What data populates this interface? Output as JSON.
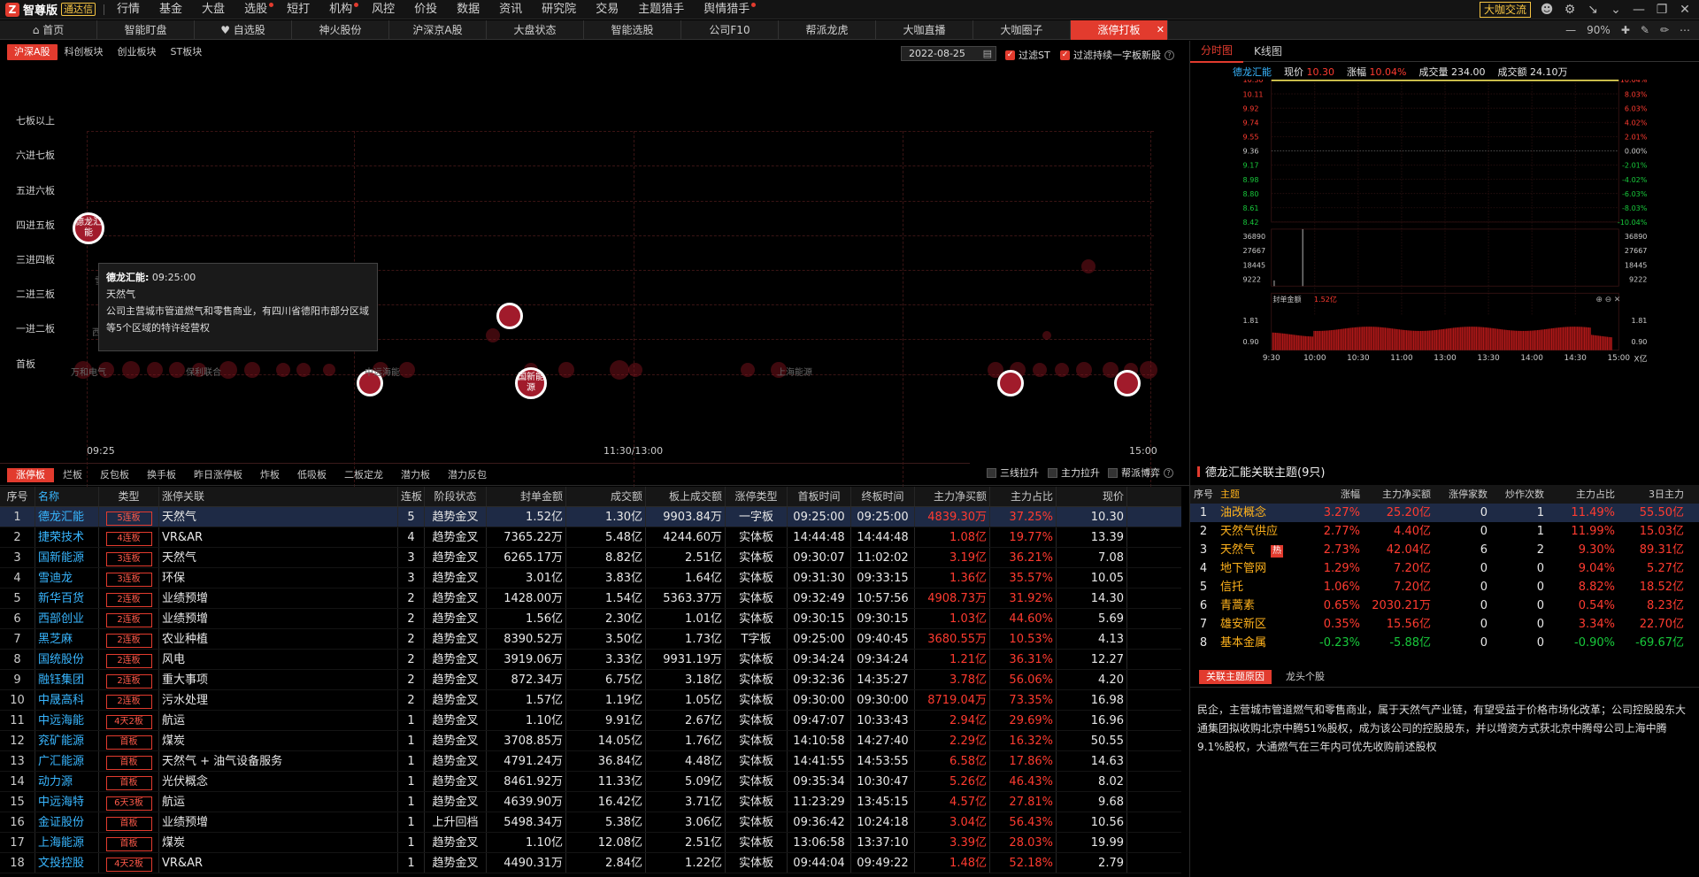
{
  "app": {
    "logo": "智尊版",
    "badge": "通达信",
    "talk_label": "大咖交流",
    "zoom": "90%"
  },
  "menu": [
    "行情",
    "基金",
    "大盘",
    "选股",
    "短打",
    "机构",
    "风控",
    "价投",
    "数据",
    "资讯",
    "研究院",
    "交易",
    "主题猎手",
    "舆情猎手"
  ],
  "menu_dots": [
    false,
    false,
    false,
    true,
    false,
    true,
    false,
    false,
    false,
    false,
    false,
    false,
    false,
    true
  ],
  "tabs": [
    "首页",
    "智能盯盘",
    "自选股",
    "神火股份",
    "沪深京A股",
    "大盘状态",
    "智能选股",
    "公司F10",
    "帮派龙虎",
    "大咖直播",
    "大咖圈子",
    "涨停打板"
  ],
  "filter": {
    "segments": [
      "沪深A股",
      "科创板块",
      "创业板块",
      "ST板块"
    ],
    "date": "2022-08-25",
    "chk_st": "过滤ST",
    "chk_new": "过滤持续一字板新股"
  },
  "levels": [
    "七板以上",
    "六进七板",
    "五进六板",
    "四进五板",
    "三进四板",
    "二进三板",
    "一进二板",
    "首板"
  ],
  "time_axis": {
    "start": "09:25",
    "mid": "11:30/13:00",
    "end": "15:00"
  },
  "bubble_labels": {
    "b1": "德龙汇能",
    "b2": "中远海能",
    "b3": "国新能源",
    "l1": "雪迪龙",
    "l2": "西部创业",
    "l3": "万和电气",
    "l4": "保利联合",
    "l5": "上海能源"
  },
  "tooltip": {
    "name": "德龙汇能:",
    "time": "09:25:00",
    "concept": "天然气",
    "desc": "公司主营城市管道燃气和零售商业，有四川省德阳市部分区域等5个区域的特许经营权"
  },
  "table_tabs": [
    "涨停板",
    "烂板",
    "反包板",
    "换手板",
    "昨日涨停板",
    "炸板",
    "低吸板",
    "二板定龙",
    "潜力板",
    "潜力反包"
  ],
  "options": [
    "三线拉升",
    "主力拉升",
    "帮派博弈"
  ],
  "columns": [
    "序号",
    "名称",
    "类型",
    "涨停关联",
    "连板",
    "阶段状态",
    "封单金额",
    "成交额",
    "板上成交额",
    "涨停类型",
    "首板时间",
    "终板时间",
    "主力净买额",
    "主力占比",
    "现价"
  ],
  "rows": [
    {
      "n": "1",
      "name": "德龙汇能",
      "type": "5连板",
      "rel": "天然气",
      "lb": "5",
      "stage": "趋势金叉",
      "seal": "1.52亿",
      "amt": "1.30亿",
      "onamt": "9903.84万",
      "lt": "一字板",
      "t1": "09:25:00",
      "t2": "09:25:00",
      "net": "4839.30万",
      "ratio": "37.25%",
      "price": "10.30"
    },
    {
      "n": "2",
      "name": "捷荣技术",
      "type": "4连板",
      "rel": "VR&AR",
      "lb": "4",
      "stage": "趋势金叉",
      "seal": "7365.22万",
      "amt": "5.48亿",
      "onamt": "4244.60万",
      "lt": "实体板",
      "t1": "14:44:48",
      "t2": "14:44:48",
      "net": "1.08亿",
      "ratio": "19.77%",
      "price": "13.39"
    },
    {
      "n": "3",
      "name": "国新能源",
      "type": "3连板",
      "rel": "天然气",
      "lb": "3",
      "stage": "趋势金叉",
      "seal": "6265.17万",
      "amt": "8.82亿",
      "onamt": "2.51亿",
      "lt": "实体板",
      "t1": "09:30:07",
      "t2": "11:02:02",
      "net": "3.19亿",
      "ratio": "36.21%",
      "price": "7.08"
    },
    {
      "n": "4",
      "name": "雪迪龙",
      "type": "3连板",
      "rel": "环保",
      "lb": "3",
      "stage": "趋势金叉",
      "seal": "3.01亿",
      "amt": "3.83亿",
      "onamt": "1.64亿",
      "lt": "实体板",
      "t1": "09:31:30",
      "t2": "09:33:15",
      "net": "1.36亿",
      "ratio": "35.57%",
      "price": "10.05"
    },
    {
      "n": "5",
      "name": "新华百货",
      "type": "2连板",
      "rel": "业绩预增",
      "lb": "2",
      "stage": "趋势金叉",
      "seal": "1428.00万",
      "amt": "1.54亿",
      "onamt": "5363.37万",
      "lt": "实体板",
      "t1": "09:32:49",
      "t2": "10:57:56",
      "net": "4908.73万",
      "ratio": "31.92%",
      "price": "14.30"
    },
    {
      "n": "6",
      "name": "西部创业",
      "type": "2连板",
      "rel": "业绩预增",
      "lb": "2",
      "stage": "趋势金叉",
      "seal": "1.56亿",
      "amt": "2.30亿",
      "onamt": "1.01亿",
      "lt": "实体板",
      "t1": "09:30:15",
      "t2": "09:30:15",
      "net": "1.03亿",
      "ratio": "44.60%",
      "price": "5.69"
    },
    {
      "n": "7",
      "name": "黑芝麻",
      "type": "2连板",
      "rel": "农业种植",
      "lb": "2",
      "stage": "趋势金叉",
      "seal": "8390.52万",
      "amt": "3.50亿",
      "onamt": "1.73亿",
      "lt": "T字板",
      "t1": "09:25:00",
      "t2": "09:40:45",
      "net": "3680.55万",
      "ratio": "10.53%",
      "price": "4.13"
    },
    {
      "n": "8",
      "name": "国统股份",
      "type": "2连板",
      "rel": "风电",
      "lb": "2",
      "stage": "趋势金叉",
      "seal": "3919.06万",
      "amt": "3.33亿",
      "onamt": "9931.19万",
      "lt": "实体板",
      "t1": "09:34:24",
      "t2": "09:34:24",
      "net": "1.21亿",
      "ratio": "36.31%",
      "price": "12.27"
    },
    {
      "n": "9",
      "name": "融钰集团",
      "type": "2连板",
      "rel": "重大事项",
      "lb": "2",
      "stage": "趋势金叉",
      "seal": "872.34万",
      "amt": "6.75亿",
      "onamt": "3.18亿",
      "lt": "实体板",
      "t1": "09:32:36",
      "t2": "14:35:27",
      "net": "3.78亿",
      "ratio": "56.06%",
      "price": "4.20"
    },
    {
      "n": "10",
      "name": "中晟高科",
      "type": "2连板",
      "rel": "污水处理",
      "lb": "2",
      "stage": "趋势金叉",
      "seal": "1.57亿",
      "amt": "1.19亿",
      "onamt": "1.05亿",
      "lt": "实体板",
      "t1": "09:30:00",
      "t2": "09:30:00",
      "net": "8719.04万",
      "ratio": "73.35%",
      "price": "16.98"
    },
    {
      "n": "11",
      "name": "中远海能",
      "type": "4天2板",
      "rel": "航运",
      "lb": "1",
      "stage": "趋势金叉",
      "seal": "1.10亿",
      "amt": "9.91亿",
      "onamt": "2.67亿",
      "lt": "实体板",
      "t1": "09:47:07",
      "t2": "10:33:43",
      "net": "2.94亿",
      "ratio": "29.69%",
      "price": "16.96"
    },
    {
      "n": "12",
      "name": "兖矿能源",
      "type": "首板",
      "rel": "煤炭",
      "lb": "1",
      "stage": "趋势金叉",
      "seal": "3708.85万",
      "amt": "14.05亿",
      "onamt": "1.76亿",
      "lt": "实体板",
      "t1": "14:10:58",
      "t2": "14:27:40",
      "net": "2.29亿",
      "ratio": "16.32%",
      "price": "50.55"
    },
    {
      "n": "13",
      "name": "广汇能源",
      "type": "首板",
      "rel": "天然气 + 油气设备服务",
      "lb": "1",
      "stage": "趋势金叉",
      "seal": "4791.24万",
      "amt": "36.84亿",
      "onamt": "4.48亿",
      "lt": "实体板",
      "t1": "14:41:55",
      "t2": "14:53:55",
      "net": "6.58亿",
      "ratio": "17.86%",
      "price": "14.63"
    },
    {
      "n": "14",
      "name": "动力源",
      "type": "首板",
      "rel": "光伏概念",
      "lb": "1",
      "stage": "趋势金叉",
      "seal": "8461.92万",
      "amt": "11.33亿",
      "onamt": "5.09亿",
      "lt": "实体板",
      "t1": "09:35:34",
      "t2": "10:30:47",
      "net": "5.26亿",
      "ratio": "46.43%",
      "price": "8.02"
    },
    {
      "n": "15",
      "name": "中远海特",
      "type": "6天3板",
      "rel": "航运",
      "lb": "1",
      "stage": "趋势金叉",
      "seal": "4639.90万",
      "amt": "16.42亿",
      "onamt": "3.71亿",
      "lt": "实体板",
      "t1": "11:23:29",
      "t2": "13:45:15",
      "net": "4.57亿",
      "ratio": "27.81%",
      "price": "9.68"
    },
    {
      "n": "16",
      "name": "金证股份",
      "type": "首板",
      "rel": "业绩预增",
      "lb": "1",
      "stage": "上升回档",
      "seal": "5498.34万",
      "amt": "5.38亿",
      "onamt": "3.06亿",
      "lt": "实体板",
      "t1": "09:36:42",
      "t2": "10:24:18",
      "net": "3.04亿",
      "ratio": "56.43%",
      "price": "10.56"
    },
    {
      "n": "17",
      "name": "上海能源",
      "type": "首板",
      "rel": "煤炭",
      "lb": "1",
      "stage": "趋势金叉",
      "seal": "1.10亿",
      "amt": "12.08亿",
      "onamt": "2.51亿",
      "lt": "实体板",
      "t1": "13:06:58",
      "t2": "13:37:10",
      "net": "3.39亿",
      "ratio": "28.03%",
      "price": "19.99"
    },
    {
      "n": "18",
      "name": "文投控股",
      "type": "4天2板",
      "rel": "VR&AR",
      "lb": "1",
      "stage": "趋势金叉",
      "seal": "4490.31万",
      "amt": "2.84亿",
      "onamt": "1.22亿",
      "lt": "实体板",
      "t1": "09:44:04",
      "t2": "09:49:22",
      "net": "1.48亿",
      "ratio": "52.18%",
      "price": "2.79"
    }
  ],
  "right_tabs": [
    "分时图",
    "K线图"
  ],
  "quote": {
    "name": "德龙汇能",
    "price_label": "现价",
    "price": "10.30",
    "chg_label": "涨幅",
    "chg": "10.04%",
    "vol_label": "成交量",
    "vol": "234.00",
    "amt_label": "成交额",
    "amt": "24.10万"
  },
  "price_axis": [
    "10.30",
    "10.11",
    "9.92",
    "9.74",
    "9.55",
    "9.36",
    "9.17",
    "8.98",
    "8.80",
    "8.61",
    "8.42"
  ],
  "pct_axis": [
    "10.04%",
    "8.03%",
    "6.03%",
    "4.02%",
    "2.01%",
    "0.00%",
    "-2.01%",
    "-4.02%",
    "-6.03%",
    "-8.03%",
    "-10.04%"
  ],
  "vol_axis": [
    "36890",
    "27667",
    "18445",
    "9222"
  ],
  "seal_label": "封单金额",
  "seal_value": "1.52亿",
  "seal_axis": [
    "1.81",
    "0.90"
  ],
  "seal_unit": "X亿",
  "time_ticks": [
    "9:30",
    "10:00",
    "10:30",
    "11:00",
    "13:00",
    "13:30",
    "14:00",
    "14:30",
    "15:00"
  ],
  "theme": {
    "title": "德龙汇能关联主题(9只)",
    "columns": [
      "序号",
      "主题",
      "涨幅",
      "主力净买额",
      "涨停家数",
      "炒作次数",
      "主力占比",
      "3日主力"
    ],
    "hot_label": "热",
    "rows": [
      {
        "n": "1",
        "name": "油改概念",
        "chg": "3.27%",
        "net": "25.20亿",
        "zt": "0",
        "cz": "1",
        "ratio": "11.49%",
        "d3": "55.50亿",
        "neg": false
      },
      {
        "n": "2",
        "name": "天然气供应",
        "chg": "2.77%",
        "net": "4.40亿",
        "zt": "0",
        "cz": "1",
        "ratio": "11.99%",
        "d3": "15.03亿",
        "neg": false
      },
      {
        "n": "3",
        "name": "天然气",
        "chg": "2.73%",
        "net": "42.04亿",
        "zt": "6",
        "cz": "2",
        "ratio": "9.30%",
        "d3": "89.31亿",
        "neg": false,
        "hot": true
      },
      {
        "n": "4",
        "name": "地下管网",
        "chg": "1.29%",
        "net": "7.20亿",
        "zt": "0",
        "cz": "0",
        "ratio": "9.04%",
        "d3": "5.27亿",
        "neg": false
      },
      {
        "n": "5",
        "name": "信托",
        "chg": "1.06%",
        "net": "7.20亿",
        "zt": "0",
        "cz": "0",
        "ratio": "8.82%",
        "d3": "18.52亿",
        "neg": false
      },
      {
        "n": "6",
        "name": "青蒿素",
        "chg": "0.65%",
        "net": "2030.21万",
        "zt": "0",
        "cz": "0",
        "ratio": "0.54%",
        "d3": "8.23亿",
        "neg": false
      },
      {
        "n": "7",
        "name": "雄安新区",
        "chg": "0.35%",
        "net": "15.56亿",
        "zt": "0",
        "cz": "0",
        "ratio": "3.34%",
        "d3": "22.70亿",
        "neg": false
      },
      {
        "n": "8",
        "name": "基本金属",
        "chg": "-0.23%",
        "net": "-5.88亿",
        "zt": "0",
        "cz": "0",
        "ratio": "-0.90%",
        "d3": "-69.67亿",
        "neg": true
      }
    ]
  },
  "reason_tabs": [
    "关联主题原因",
    "龙头个股"
  ],
  "reason_text": "民企，主营城市管道燃气和零售商业，属于天然气产业链，有望受益于价格市场化改革；公司控股股东大通集团拟收购北京中腾51%股权，成为该公司的控股股东，并以增资方式获北京中腾母公司上海中腾9.1%股权，大通燃气在三年内可优先收购前述股权",
  "colors": {
    "accent": "#e23b2e",
    "rise": "#ff3b30",
    "fall": "#18c93b",
    "stock_name": "#38b6ff",
    "theme_name": "#ffb21c"
  }
}
